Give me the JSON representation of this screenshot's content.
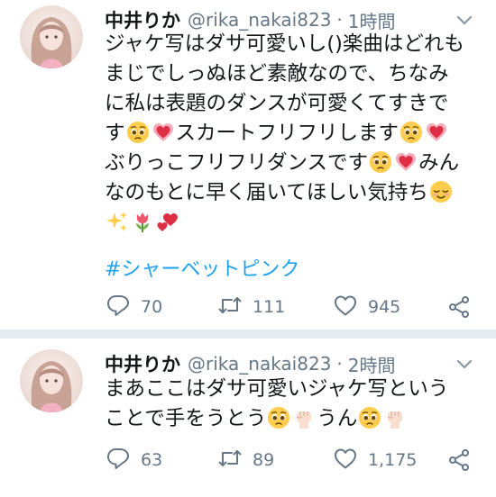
{
  "tweets": [
    {
      "display_name": "中井りか",
      "handle": "@rika_nakai823",
      "separator": "·",
      "time": "1時間",
      "lines": [
        {
          "segments": [
            {
              "t": "text",
              "v": "ジャケ写はダサ可愛いし()楽曲はどれも"
            }
          ]
        },
        {
          "segments": [
            {
              "t": "text",
              "v": "まじでしっぬほど素敵なので、ちなみ"
            }
          ]
        },
        {
          "segments": [
            {
              "t": "text",
              "v": "に私は表題のダンスが可愛くてすきで"
            }
          ]
        },
        {
          "segments": [
            {
              "t": "text",
              "v": "す"
            },
            {
              "t": "emoji",
              "v": "pleading-face"
            },
            {
              "t": "emoji",
              "v": "growing-heart"
            },
            {
              "t": "text",
              "v": "スカートフリフリします"
            },
            {
              "t": "emoji",
              "v": "pleading-face"
            },
            {
              "t": "emoji",
              "v": "growing-heart"
            }
          ]
        },
        {
          "segments": [
            {
              "t": "text",
              "v": "ぶりっこフリフリダンスです"
            },
            {
              "t": "emoji",
              "v": "pleading-face"
            },
            {
              "t": "emoji",
              "v": "growing-heart"
            },
            {
              "t": "text",
              "v": "みん"
            }
          ]
        },
        {
          "segments": [
            {
              "t": "text",
              "v": "なのもとに早く届いてほしい気持ち"
            },
            {
              "t": "emoji",
              "v": "relieved-face"
            }
          ]
        },
        {
          "segments": [
            {
              "t": "emoji",
              "v": "sparkles"
            },
            {
              "t": "emoji",
              "v": "tulip"
            },
            {
              "t": "emoji",
              "v": "two-hearts"
            }
          ]
        }
      ],
      "hashtag": "#シャーベットピンク",
      "reply_count": "70",
      "retweet_count": "111",
      "like_count": "945"
    },
    {
      "display_name": "中井りか",
      "handle": "@rika_nakai823",
      "separator": "·",
      "time": "2時間",
      "lines": [
        {
          "segments": [
            {
              "t": "text",
              "v": "まあここはダサ可愛いジャケ写という"
            }
          ]
        },
        {
          "segments": [
            {
              "t": "text",
              "v": "ことで手をうとう"
            },
            {
              "t": "emoji",
              "v": "pleading-face"
            },
            {
              "t": "emoji",
              "v": "raised-fist"
            },
            {
              "t": "text",
              "v": "うん"
            },
            {
              "t": "emoji",
              "v": "pleading-face"
            },
            {
              "t": "emoji",
              "v": "raised-fist"
            }
          ]
        }
      ],
      "hashtag": "",
      "reply_count": "63",
      "retweet_count": "89",
      "like_count": "1,175"
    }
  ],
  "colors": {
    "text": "#14171a",
    "secondary": "#657786",
    "link": "#1da1f2",
    "divider": "#e6ecf0"
  },
  "icons": [
    "chevron-down-icon",
    "reply-icon",
    "retweet-icon",
    "like-icon",
    "share-icon"
  ]
}
